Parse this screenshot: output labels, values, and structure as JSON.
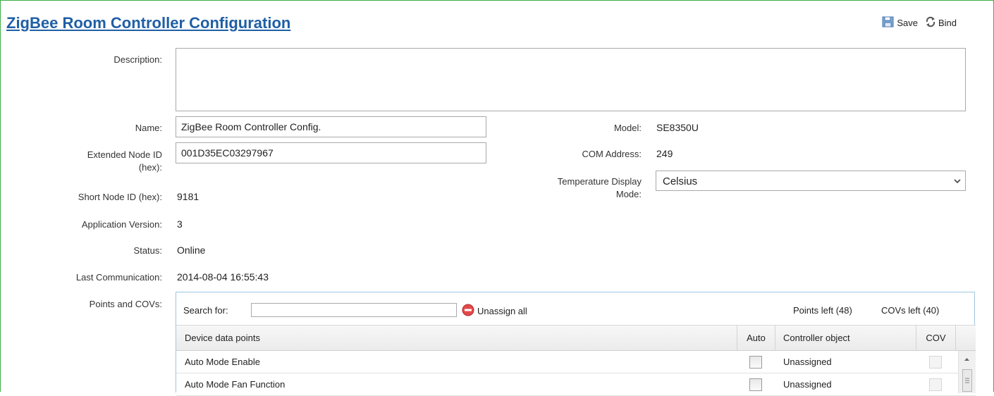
{
  "page": {
    "title": "ZigBee Room Controller Configuration",
    "save_label": "Save",
    "bind_label": "Bind"
  },
  "form": {
    "description_label": "Description:",
    "description_value": "",
    "name_label": "Name:",
    "name_value": "ZigBee Room Controller Config.",
    "ext_node_label_1": "Extended Node ID",
    "ext_node_label_2": "(hex):",
    "ext_node_value": "001D35EC03297967",
    "short_node_label": "Short Node ID (hex):",
    "short_node_value": "9181",
    "app_version_label": "Application Version:",
    "app_version_value": "3",
    "status_label": "Status:",
    "status_value": "Online",
    "last_comm_label": "Last Communication:",
    "last_comm_value": "2014-08-04 16:55:43",
    "points_label": "Points and COVs:",
    "model_label": "Model:",
    "model_value": "SE8350U",
    "com_label": "COM Address:",
    "com_value": "249",
    "temp_label_1": "Temperature Display",
    "temp_label_2": "Mode:",
    "temp_value": "Celsius"
  },
  "points": {
    "search_label": "Search for:",
    "search_value": "",
    "unassign_label": "Unassign all",
    "points_left": "Points left (48)",
    "covs_left": "COVs left (40)",
    "columns": [
      "Device data points",
      "Auto",
      "Controller object",
      "COV"
    ],
    "rows": [
      {
        "point": "Auto Mode Enable",
        "controller": "Unassigned"
      },
      {
        "point": "Auto Mode Fan Function",
        "controller": "Unassigned"
      }
    ]
  },
  "colors": {
    "title": "#1f5fa5",
    "frame_border": "#3fae49",
    "panel_border": "#9fc4e0",
    "unassign_icon": "#e24a4a"
  },
  "icons": {
    "save": "save-disk-icon",
    "bind": "refresh-icon",
    "unassign": "minus-circle-icon",
    "dropdown": "chevron-down-icon"
  }
}
